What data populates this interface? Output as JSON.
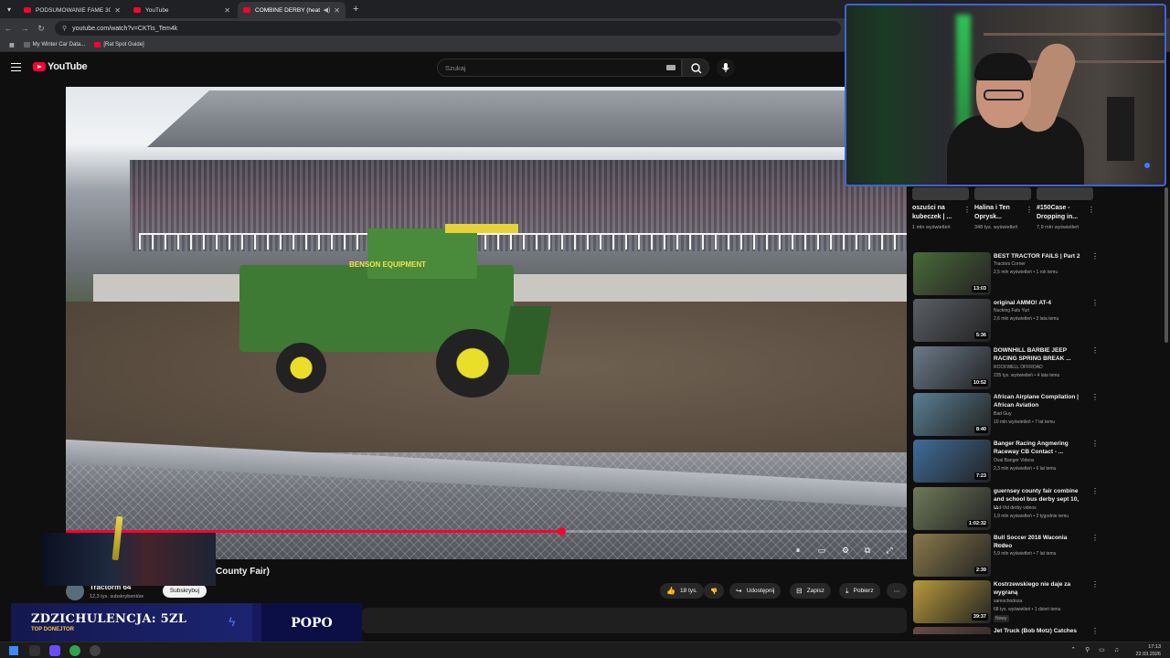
{
  "browser": {
    "tabs": [
      {
        "label": "PODSUMOWANIE FAME 30 (D"
      },
      {
        "label": "YouTube"
      },
      {
        "label": "COMBINE DERBY (heat #1"
      }
    ],
    "url": "youtube.com/watch?v=CKTis_Tem4k",
    "bookmarks": [
      "My Winter Car Data...",
      "[Rat Spot Guide]"
    ]
  },
  "youtube": {
    "logo": "YouTube",
    "search_placeholder": "Szukaj"
  },
  "video": {
    "title_fragment": "County Fair)",
    "progress_fraction": 0.59,
    "channel": {
      "name": "Tractorm 64",
      "subs": "12,3 tys. subskrybentów"
    },
    "subscribe_label": "Subskrybuj",
    "actions": {
      "likes": "18 tys.",
      "share": "Udostępnij",
      "save": "Zapisz",
      "download": "Pobierz"
    },
    "combine_text": "BENSON EQUIPMENT"
  },
  "shorts": [
    {
      "title": "oszuści na kubeczek | ...",
      "views": "1 mln wyświetleń"
    },
    {
      "title": "Halina i Ten Oprysk...",
      "views": "348 tys. wyświetleń"
    },
    {
      "title": "#150Case - Dropping in...",
      "views": "7,9 mln wyświetleń"
    }
  ],
  "recommendations": [
    {
      "title": "BEST TRACTOR FAILS | Part 2",
      "channel": "Tractors Corner",
      "meta": "2,5 mln wyświetleń • 1 rok temu",
      "duration": "13:03",
      "thumb": "#4a6b3a"
    },
    {
      "title": "original AMMO! AT-4",
      "channel": "Nucking Futs Yuri",
      "meta": "2,6 mln wyświetleń • 3 lata temu",
      "duration": "5:36",
      "thumb": "#5b6066"
    },
    {
      "title": "DOWNHILL BARBIE JEEP RACING SPRING BREAK ...",
      "channel": "ROCKWELL OFFROAD",
      "meta": "235 tys. wyświetleń • 4 lata temu",
      "duration": "10:52",
      "thumb": "#6b7b8a"
    },
    {
      "title": "African Airplane Compilation | African Aviation",
      "channel": "Bad Guy",
      "meta": "10 mln wyświetleń • 7 lat temu",
      "duration": "8:40",
      "thumb": "#5a7f92"
    },
    {
      "title": "Banger Racing Angmering Raceway CB Contact - ...",
      "channel": "Oval Banger Videos",
      "meta": "2,3 mln wyświetleń • 6 lat temu",
      "duration": "7:23",
      "thumb": "#3f6d9a"
    },
    {
      "title": "guernsey county fair combine and school bus derby sept 10, ...",
      "channel": "Mid-Vid derby videos",
      "meta": "1,9 mln wyświetleń • 3 tygodnie temu",
      "duration": "1:02:32",
      "thumb": "#6f7a5a"
    },
    {
      "title": "Bull Soccer 2018 Waconia Rodeo",
      "channel": "Vinnie",
      "meta": "5,9 mln wyświetleń • 7 lat temu",
      "duration": "2:39",
      "thumb": "#8a7a4a"
    },
    {
      "title": "Kostrzewskiego nie daje za wygraną",
      "channel": "samochodoza",
      "meta": "68 tys. wyświetleń • 1 dzień temu",
      "duration": "39:37",
      "thumb": "#b89a3a",
      "badge": "Nowy"
    },
    {
      "title": "Jet Truck (Bob Motz) Catches",
      "channel": "",
      "meta": "",
      "duration": "",
      "thumb": "#6a4a4a"
    }
  ],
  "donation": {
    "amount_text": "ZDZICHULENCJA: 5ZL",
    "sub_text": "TOP DONEJTOR",
    "right_text": "POPO"
  },
  "taskbar": {
    "time": "17:13",
    "date": "22.03.2026"
  }
}
